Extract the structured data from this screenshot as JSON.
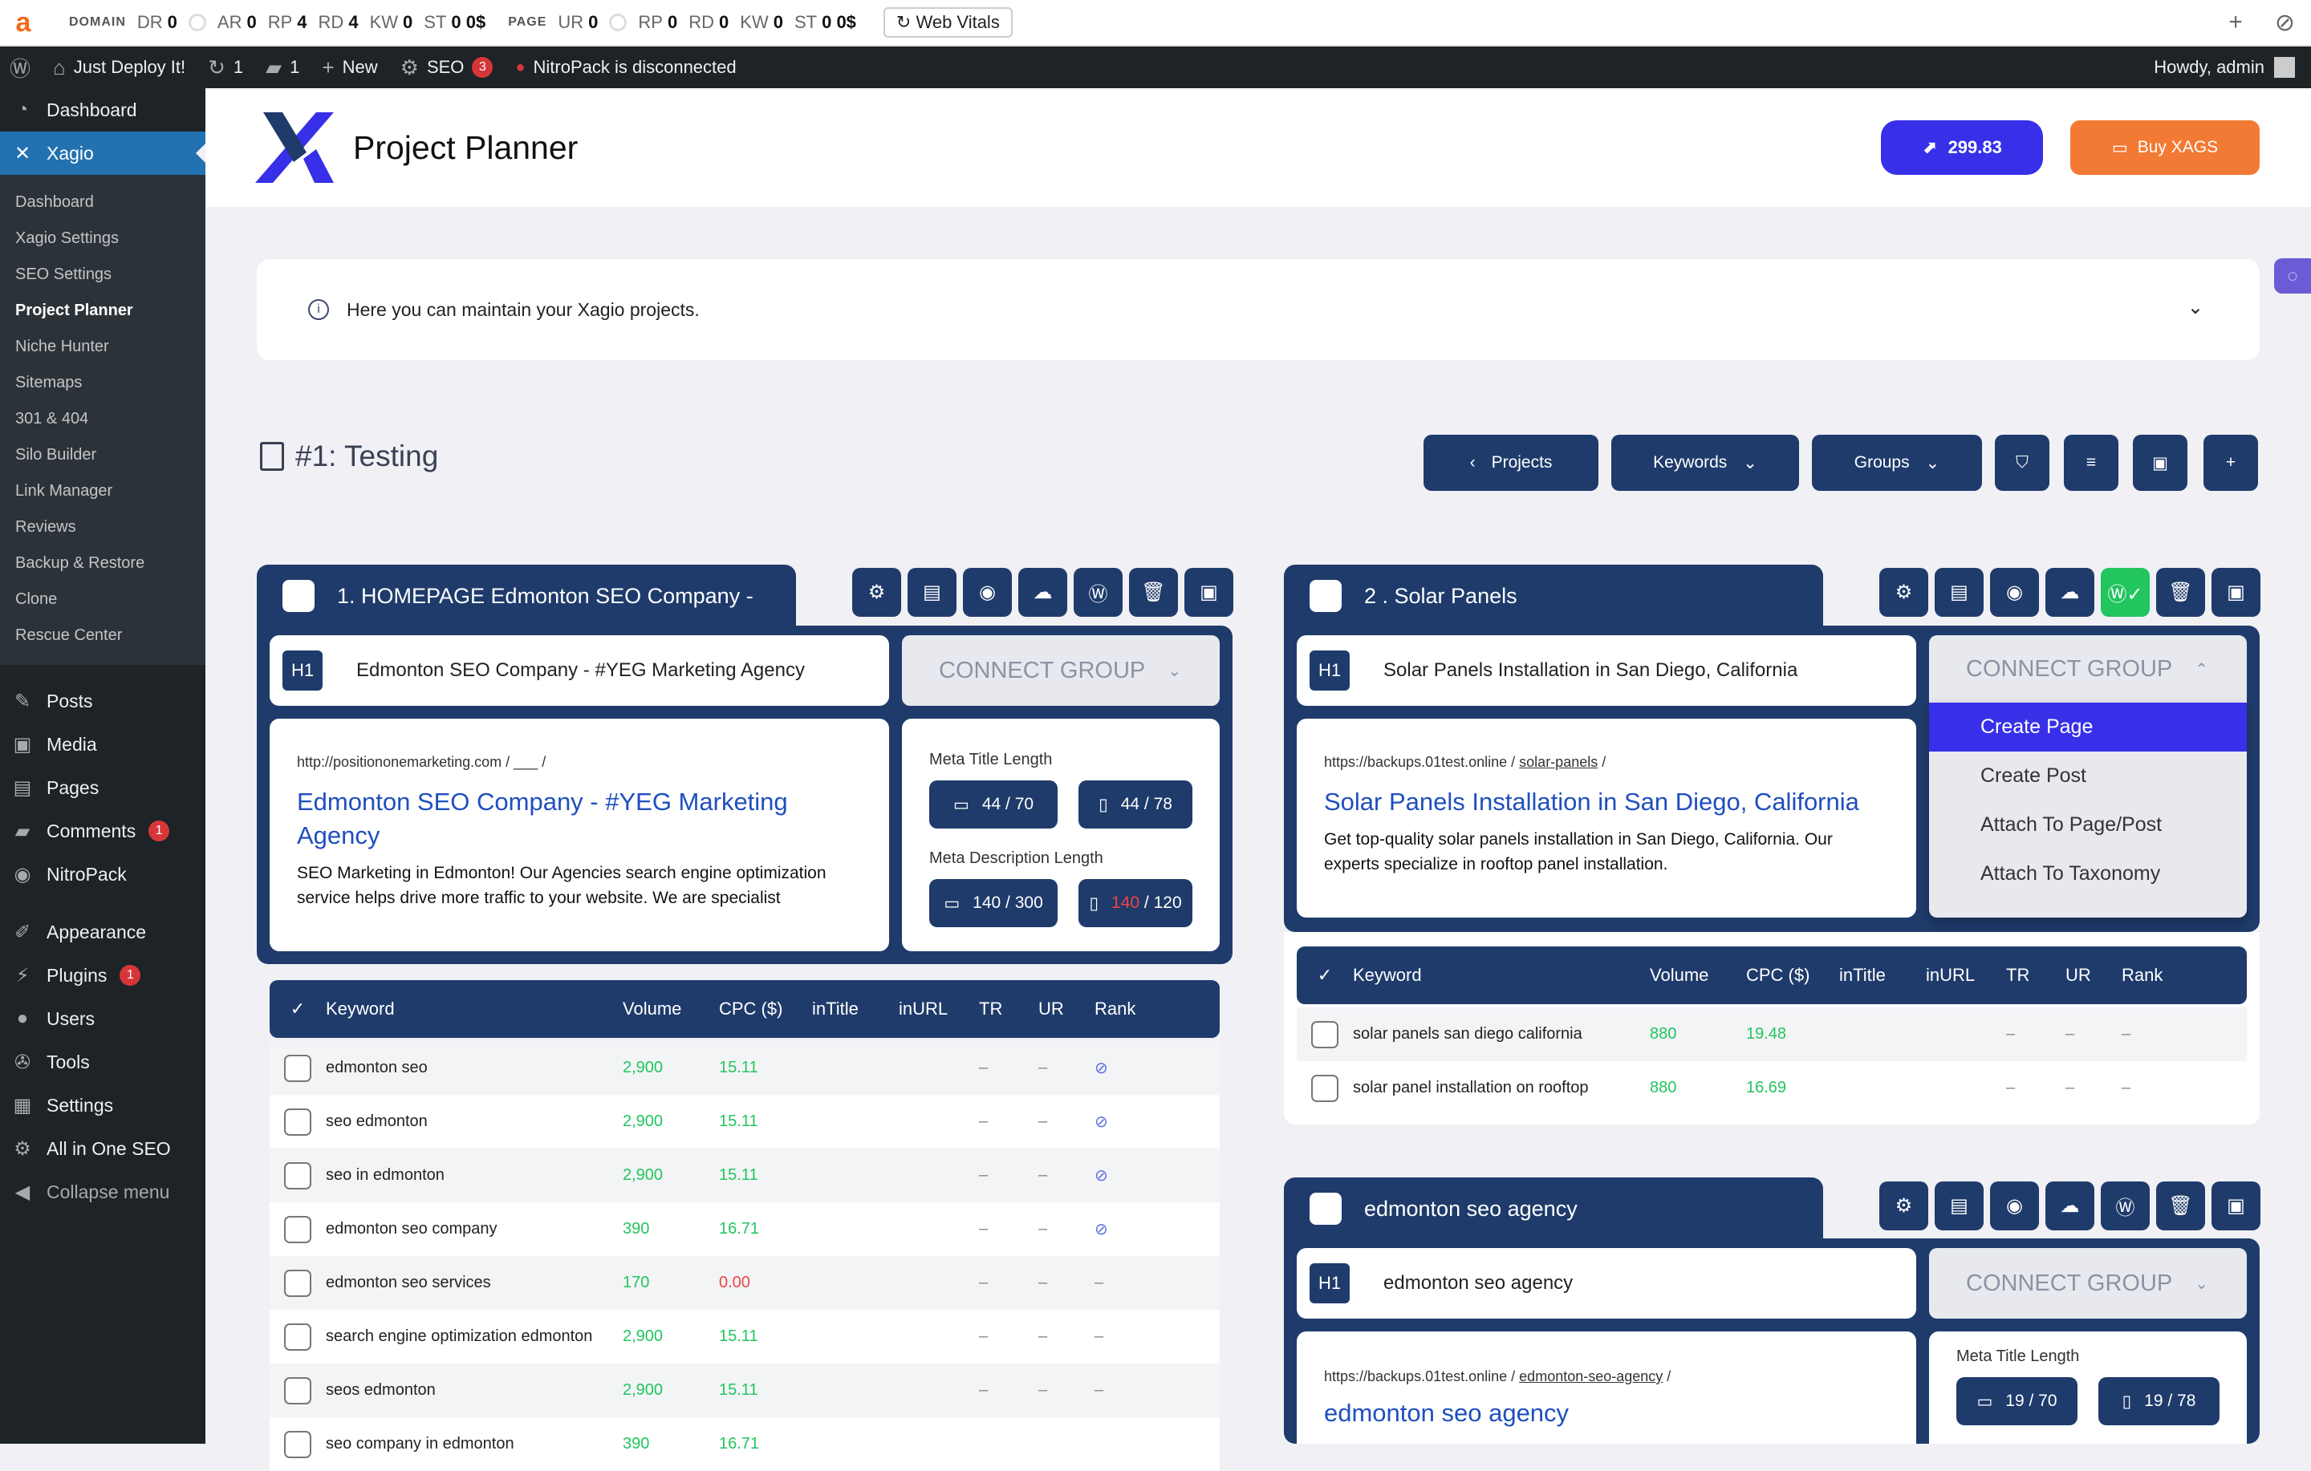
{
  "ahrefs": {
    "domain_label": "DOMAIN",
    "page_label": "PAGE",
    "domain_metrics": [
      [
        "DR",
        "0"
      ],
      [
        "AR",
        "0"
      ],
      [
        "RP",
        "4"
      ],
      [
        "RD",
        "4"
      ],
      [
        "KW",
        "0"
      ],
      [
        "ST",
        "0 0$"
      ]
    ],
    "page_metrics": [
      [
        "UR",
        "0"
      ],
      [
        "RP",
        "0"
      ],
      [
        "RD",
        "0"
      ],
      [
        "KW",
        "0"
      ],
      [
        "ST",
        "0 0$"
      ]
    ],
    "web_vitals": "Web Vitals"
  },
  "wpbar": {
    "site": "Just Deploy It!",
    "updates": "1",
    "comments": "1",
    "new": "New",
    "seo": "SEO",
    "seo_badge": "3",
    "nitro": "NitroPack is disconnected",
    "howdy": "Howdy, admin"
  },
  "sidebar": {
    "dashboard": "Dashboard",
    "xagio": "Xagio",
    "sub": [
      "Dashboard",
      "Xagio Settings",
      "SEO Settings",
      "Project Planner",
      "Niche Hunter",
      "Sitemaps",
      "301 & 404",
      "Silo Builder",
      "Link Manager",
      "Reviews",
      "Backup & Restore",
      "Clone",
      "Rescue Center"
    ],
    "posts": "Posts",
    "media": "Media",
    "pages": "Pages",
    "comments": "Comments",
    "comments_badge": "1",
    "nitropack": "NitroPack",
    "appearance": "Appearance",
    "plugins": "Plugins",
    "plugins_badge": "1",
    "users": "Users",
    "tools": "Tools",
    "settings": "Settings",
    "aioseo": "All in One SEO",
    "collapse": "Collapse menu"
  },
  "header": {
    "title": "Project Planner",
    "credits": "299.83",
    "buy": "Buy XAGS"
  },
  "info": "Here you can maintain your Xagio projects.",
  "project": {
    "title": "#1: Testing",
    "projects_btn": "Projects",
    "keywords_btn": "Keywords",
    "groups_btn": "Groups"
  },
  "groups": [
    {
      "title": "1. HOMEPAGE Edmonton SEO Company -",
      "h1": "Edmonton SEO Company - #YEG Marketing Agency",
      "connect": "CONNECT GROUP",
      "url": "http://positiononemarketing.com",
      "url_slug": "___",
      "preview_title": "Edmonton SEO Company - #YEG Marketing Agency",
      "preview_desc": "SEO Marketing in Edmonton! Our Agencies search engine optimization service helps drive more traffic to your website. We are specialist",
      "meta_title_label": "Meta Title Length",
      "meta_desc_label": "Meta Description Length",
      "mt_desktop": "44 / 70",
      "mt_mobile": "44 / 78",
      "md_desktop": "140 / 300",
      "md_mobile_val": "140",
      "md_mobile_max": " / 120",
      "columns": [
        "Keyword",
        "Volume",
        "CPC ($)",
        "inTitle",
        "inURL",
        "TR",
        "UR",
        "Rank"
      ],
      "rows": [
        [
          "edmonton seo",
          "2,900",
          "15.11",
          "",
          "",
          "–",
          "–",
          "rank-icon"
        ],
        [
          "seo edmonton",
          "2,900",
          "15.11",
          "",
          "",
          "–",
          "–",
          "rank-icon"
        ],
        [
          "seo in edmonton",
          "2,900",
          "15.11",
          "",
          "",
          "–",
          "–",
          "rank-icon"
        ],
        [
          "edmonton seo company",
          "390",
          "16.71",
          "",
          "",
          "–",
          "–",
          "rank-icon"
        ],
        [
          "edmonton seo services",
          "170",
          "0.00",
          "",
          "",
          "–",
          "–",
          "–"
        ],
        [
          "search engine optimization edmonton",
          "2,900",
          "15.11",
          "",
          "",
          "–",
          "–",
          "–"
        ],
        [
          "seos edmonton",
          "2,900",
          "15.11",
          "",
          "",
          "–",
          "–",
          "–"
        ],
        [
          "seo company in edmonton",
          "390",
          "16.71",
          "",
          "",
          "",
          "",
          ""
        ]
      ]
    },
    {
      "title": "2 . Solar Panels",
      "h1": "Solar Panels Installation in San Diego, California",
      "connect": "CONNECT GROUP",
      "url": "https://backups.01test.online",
      "url_slug": "solar-panels",
      "preview_title": "Solar Panels Installation in San Diego, California",
      "preview_desc": "Get top-quality solar panels installation in San Diego, California. Our experts specialize in rooftop panel installation.",
      "dropdown": [
        "Create Page",
        "Create Post",
        "Attach To Page/Post",
        "Attach To Taxonomy"
      ],
      "columns": [
        "Keyword",
        "Volume",
        "CPC ($)",
        "inTitle",
        "inURL",
        "TR",
        "UR",
        "Rank"
      ],
      "rows": [
        [
          "solar panels san diego california",
          "880",
          "19.48",
          "",
          "",
          "–",
          "–",
          "–"
        ],
        [
          "solar panel installation on rooftop",
          "880",
          "16.69",
          "",
          "",
          "–",
          "–",
          "–"
        ]
      ]
    },
    {
      "title": "edmonton seo agency",
      "h1": "edmonton seo agency",
      "connect": "CONNECT GROUP",
      "url": "https://backups.01test.online",
      "url_slug": "edmonton-seo-agency",
      "preview_title": "edmonton seo agency",
      "meta_title_label": "Meta Title Length",
      "mt_desktop": "19 / 70",
      "mt_mobile": "19 / 78"
    }
  ],
  "colors": {
    "navy": "#1f3b6b",
    "accent": "#3730e8",
    "orange": "#f27a35",
    "green": "#22c55e",
    "red": "#ef4444"
  }
}
